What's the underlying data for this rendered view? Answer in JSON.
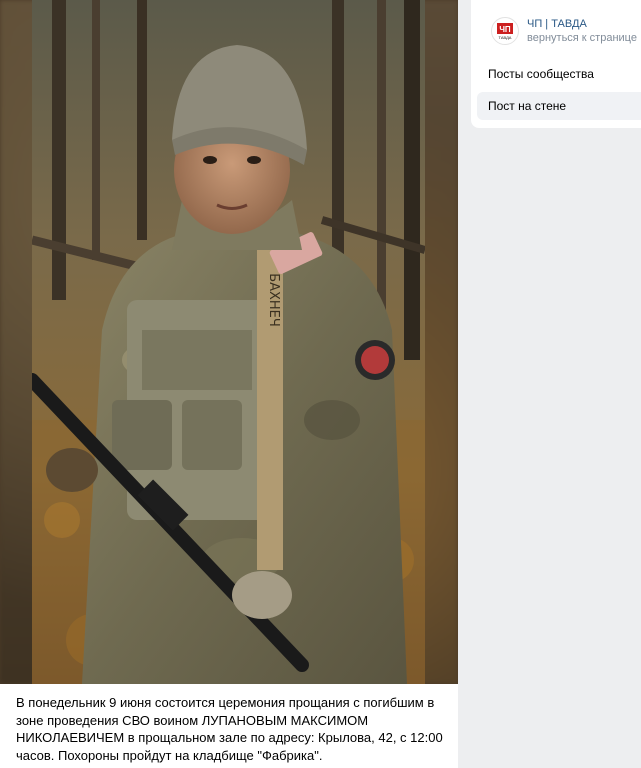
{
  "post": {
    "text": "В понедельник 9 июня состоится церемония прощания с погибшим в зоне проведения СВО воином ЛУПАНОВЫМ МАКСИМОМ НИКОЛАЕВИЧЕМ в прощальном зале по адресу: Крылова, 42, с 12:00 часов. Похороны пройдут на кладбище \"Фабрика\".",
    "photo": {
      "subject": "soldier-in-camouflage-portrait",
      "strap_text": "БАХНЕЧ"
    }
  },
  "sidebar": {
    "community": {
      "logo_text": "ЧП",
      "logo_subtext": "ТАВДА",
      "name": "ЧП | ТАВДА",
      "back_link": "вернуться к странице"
    },
    "menu": [
      {
        "label": "Посты сообщества",
        "active": false
      },
      {
        "label": "Пост на стене",
        "active": true
      }
    ]
  },
  "colors": {
    "page_bg": "#edeef0",
    "link": "#2a5885",
    "secondary_text": "#818c99",
    "logo_red": "#cc1f1f",
    "active_item_bg": "#f0f2f5"
  }
}
